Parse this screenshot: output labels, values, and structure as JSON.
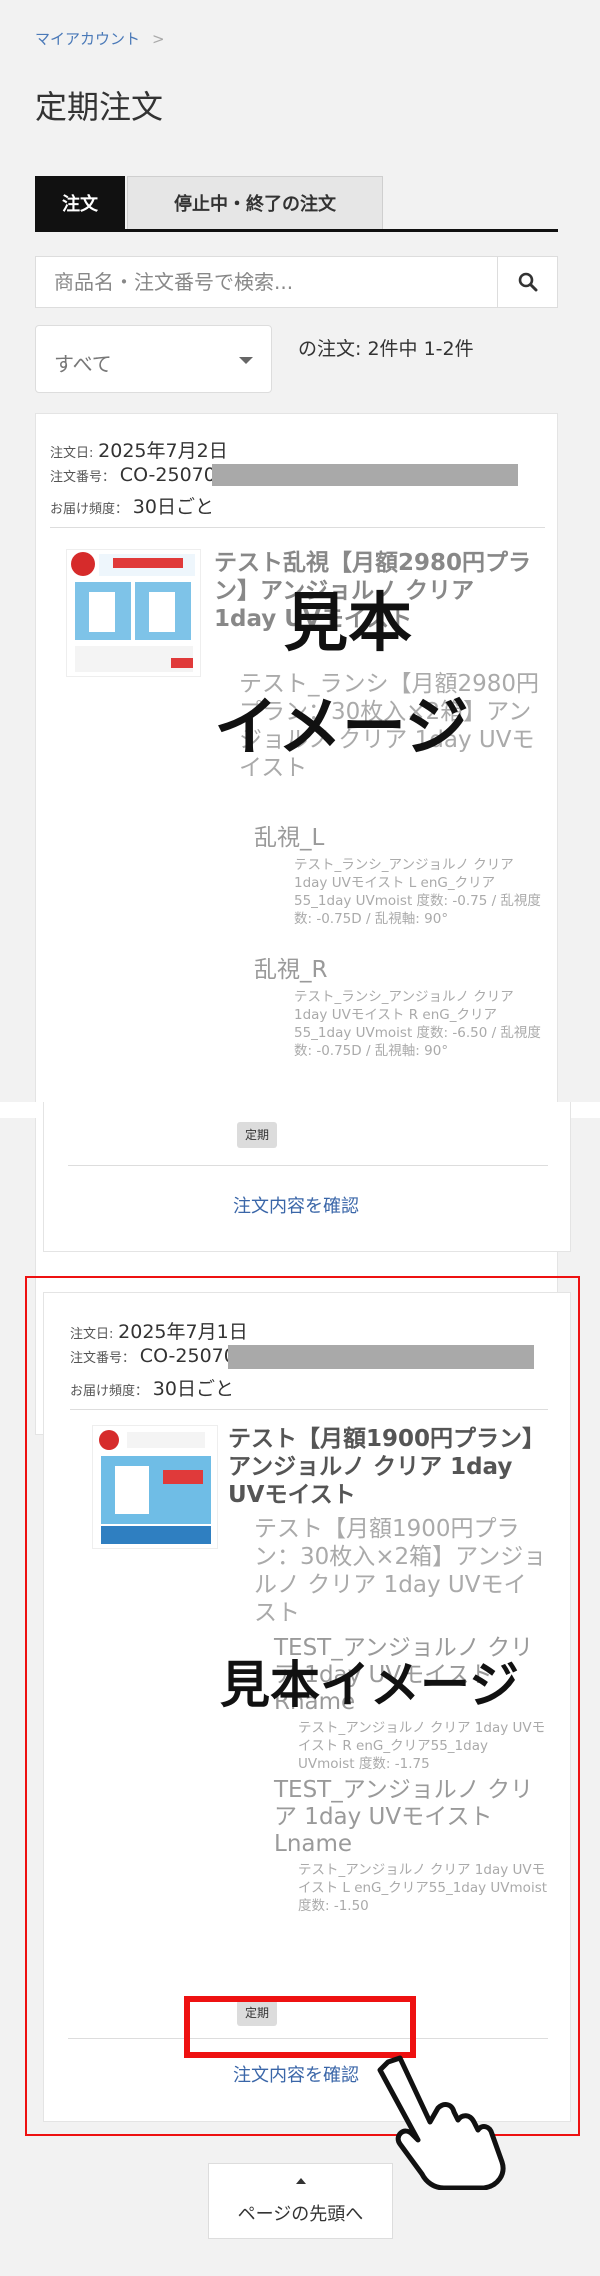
{
  "breadcrumb": {
    "item": "マイアカウント",
    "separator": ">"
  },
  "page_title": "定期注文",
  "tabs": [
    {
      "label": "注文",
      "active": true
    },
    {
      "label": "停止中・終了の注文",
      "active": false
    }
  ],
  "search": {
    "placeholder": "商品名・注文番号で検索...",
    "icon": "search-icon"
  },
  "filter": {
    "selected": "すべて",
    "icon": "chevron-down-icon"
  },
  "order_count": "の注文: 2件中 1-2件",
  "orders": [
    {
      "date_label": "注文日:",
      "date": "2025年7月2日",
      "number_label": "注文番号：",
      "number": "CO-25070",
      "frequency_label": "お届け頻度：",
      "frequency": "30日ごと",
      "product_name": "テスト乱視【月額2980円プラン】アンジョルノ クリア 1day UVモイスト",
      "product_sub": "テスト_ランシ【月額2980円プラン：30枚入×2箱】アンジョルノ クリア 1day UVモイスト",
      "options": [
        {
          "name": "乱視_L",
          "detail": "テスト_ランシ_アンジョルノ クリア 1day UVモイスト L enG_クリア55_1day UVmoist 度数: -0.75 / 乱視度数: -0.75D / 乱視軸: 90°"
        },
        {
          "name": "乱視_R",
          "detail": "テスト_ランシ_アンジョルノ クリア 1day UVモイスト R enG_クリア55_1day UVmoist 度数: -6.50 / 乱視度数: -0.75D / 乱視軸: 90°"
        }
      ],
      "badge": "定期",
      "confirm_label": "注文内容を確認",
      "sample_label": [
        "見本",
        "イメージ"
      ]
    },
    {
      "date_label": "注文日:",
      "date": "2025年7月1日",
      "number_label": "注文番号：",
      "number": "CO-250701",
      "frequency_label": "お届け頻度：",
      "frequency": "30日ごと",
      "product_name": "テスト【月額1900円プラン】アンジョルノ クリア 1day UVモイスト",
      "product_sub": "テスト【月額1900円プラン：30枚入×2箱】アンジョルノ クリア 1day UVモイスト",
      "options": [
        {
          "name": "TEST_アンジョルノ クリア 1day UVモイスト Rname",
          "detail": "テスト_アンジョルノ クリア 1day UVモイスト R enG_クリア55_1day UVmoist 度数: -1.75"
        },
        {
          "name": "TEST_アンジョルノ クリア 1day UVモイスト Lname",
          "detail": "テスト_アンジョルノ クリア 1day UVモイスト L enG_クリア55_1day UVmoist 度数: -1.50"
        }
      ],
      "badge": "定期",
      "confirm_label": "注文内容を確認",
      "sample_label": [
        "見本イメージ"
      ]
    }
  ],
  "scroll_top_label": "ページの先頭へ",
  "colors": {
    "highlight": "#ee1111",
    "link": "#3a66a8",
    "tab_active": "#111111"
  }
}
